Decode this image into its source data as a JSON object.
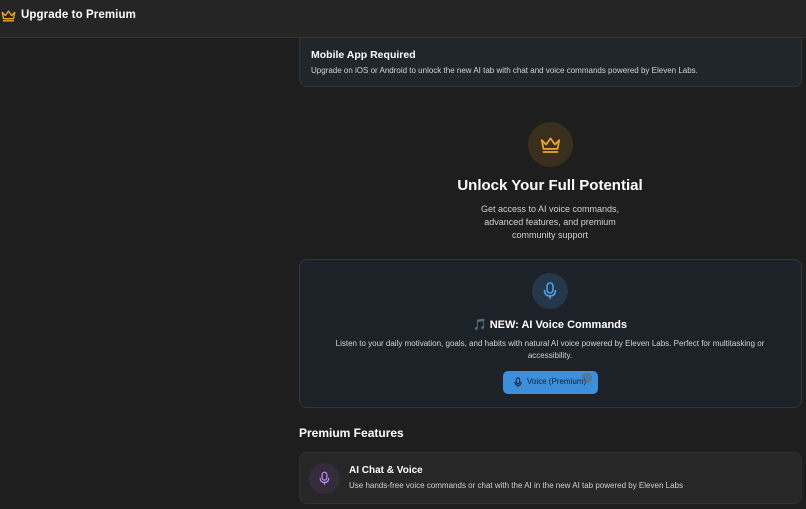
{
  "header": {
    "title": "Upgrade to Premium",
    "icon": "crown-icon"
  },
  "notice": {
    "title": "Mobile App Required",
    "description": "Upgrade on iOS or Android to unlock the new AI tab with chat and voice commands powered by Eleven Labs."
  },
  "hero": {
    "icon": "crown-icon",
    "title": "Unlock Your Full Potential",
    "subtitle": "Get access to AI voice commands, advanced features, and premium community support"
  },
  "voice_promo": {
    "icon": "microphone-icon",
    "emoji": "🎵",
    "heading": "NEW: AI Voice Commands",
    "description": "Listen to your daily motivation, goals, and habits with natural AI voice powered by Eleven Labs. Perfect for multitasking or accessibility.",
    "button_label": "Voice (Premium)"
  },
  "features": {
    "section_title": "Premium Features",
    "items": [
      {
        "icon": "microphone-icon",
        "title": "AI Chat & Voice",
        "description": "Use hands-free voice commands or chat with the AI in the new AI tab powered by Eleven Labs"
      }
    ]
  },
  "colors": {
    "accent_gold": "#f0a429",
    "accent_blue": "#3d8fdc",
    "accent_purple": "#b58cf0",
    "background": "#1e1e1e"
  }
}
